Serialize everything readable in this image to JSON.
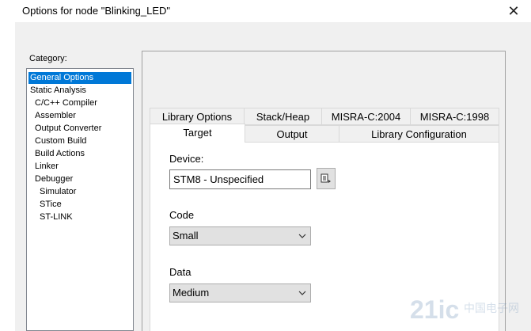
{
  "window": {
    "title": "Options for node \"Blinking_LED\"",
    "close_glyph": "✕"
  },
  "category": {
    "label": "Category:",
    "items": [
      {
        "label": "General Options",
        "selected": true
      },
      {
        "label": "Static Analysis"
      },
      {
        "label": "C/C++ Compiler"
      },
      {
        "label": "Assembler"
      },
      {
        "label": "Output Converter"
      },
      {
        "label": "Custom Build"
      },
      {
        "label": "Build Actions"
      },
      {
        "label": "Linker"
      },
      {
        "label": "Debugger"
      },
      {
        "label": "Simulator"
      },
      {
        "label": "STice"
      },
      {
        "label": "ST-LINK"
      }
    ]
  },
  "tabs": {
    "row1": [
      "Library Options",
      "Stack/Heap",
      "MISRA-C:2004",
      "MISRA-C:1998"
    ],
    "row2": [
      "Target",
      "Output",
      "Library Configuration"
    ],
    "active": "Target"
  },
  "target": {
    "device_label": "Device:",
    "device_value": "STM8 - Unspecified",
    "code_label": "Code",
    "code_value": "Small",
    "data_label": "Data",
    "data_value": "Medium"
  },
  "watermark": {
    "text": "21ic",
    "subtext": "中国电子网"
  },
  "colors": {
    "selection": "#0078d7",
    "dialog_bg": "#f0f0f0"
  }
}
